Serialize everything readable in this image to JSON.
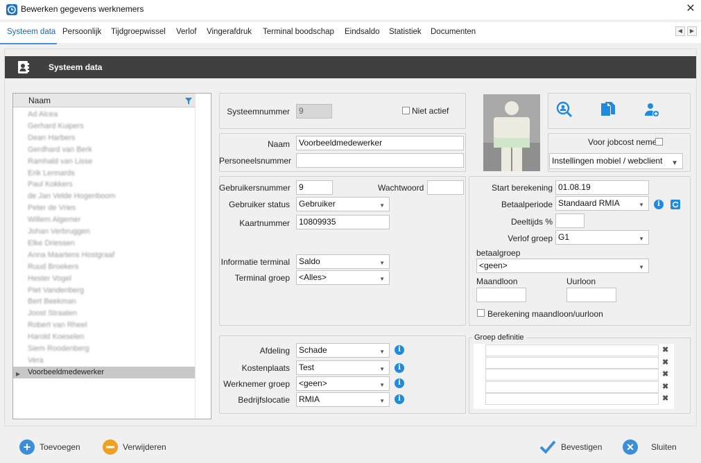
{
  "window": {
    "title": "Bewerken gegevens werknemers",
    "close_glyph": "✕",
    "icon": "app-clock-icon"
  },
  "tabs": [
    {
      "label": "Systeem data",
      "active": true
    },
    {
      "label": "Persoonlijk"
    },
    {
      "label": "Tijdgroepwissel"
    },
    {
      "label": "Verlof"
    },
    {
      "label": "Vingerafdruk"
    },
    {
      "label": "Terminal boodschap"
    },
    {
      "label": "Eindsaldo"
    },
    {
      "label": "Statistiek"
    },
    {
      "label": "Documenten"
    }
  ],
  "tab_nav": {
    "prev": "◀",
    "next": "▶"
  },
  "section": {
    "title": "Systeem data",
    "icon": "contact-card-icon"
  },
  "employee_list": {
    "header": "Naam",
    "rows": [
      "Ad Alcea",
      "Gerhard Kuipers",
      "Dean Harbers",
      "Gerdhard van Berk",
      "Ramhald van Lisse",
      "Erik Lennards",
      "Paul Kokkers",
      "de Jan Velde Hogenboom",
      "Peter de Vries",
      "Willem Algemer",
      "Johan Verbruggen",
      "Elke Driessen",
      "Anna Maartens Hostgraaf",
      "Ruud Broekers",
      "Hester Vogel",
      "Piet Vandenberg",
      "Bert Beekman",
      "Joost Straaten",
      "Robert van Rheel",
      "Harold Koeselen",
      "Siem Roodenberg",
      "Vera",
      "Voorbeeldmedewerker"
    ],
    "selected_index": 22,
    "row_pointer": "▶"
  },
  "system": {
    "systeemnummer_label": "Systeemnummer",
    "systeemnummer": "9",
    "niet_actief_label": "Niet actief",
    "niet_actief": false
  },
  "identity": {
    "naam_label": "Naam",
    "naam": "Voorbeeldmedewerker",
    "personeelsnummer_label": "Personeelsnummer",
    "personeelsnummer": ""
  },
  "actions": {
    "icons": [
      "search-user-icon",
      "documents-icon",
      "add-user-icon"
    ],
    "jobcost_label": "Voor jobcost nemen",
    "jobcost": false,
    "mobile_select": "Instellingen mobiel / webclient"
  },
  "terminal": {
    "gebruikersnummer_label": "Gebruikersnummer",
    "gebruikersnummer": "9",
    "wachtwoord_label": "Wachtwoord",
    "wachtwoord": "",
    "gebruiker_status_label": "Gebruiker status",
    "gebruiker_status": "Gebruiker",
    "kaartnummer_label": "Kaartnummer",
    "kaartnummer": "10809935",
    "informatie_terminal_label": "Informatie terminal",
    "informatie_terminal": "Saldo",
    "terminal_groep_label": "Terminal groep",
    "terminal_groep": "<Alles>"
  },
  "payroll": {
    "start_berekening_label": "Start berekening",
    "start_berekening": "01.08.19",
    "betaalperiode_label": "Betaalperiode",
    "betaalperiode": "Standaard RMIA",
    "deeltijds_label": "Deeltijds %",
    "deeltijds": "",
    "verlof_groep_label": "Verlof groep",
    "verlof_groep": "G1",
    "betaalgroep_label": "betaalgroep",
    "betaalgroep": "<geen>",
    "maandloon_label": "Maandloon",
    "maandloon": "",
    "uurloon_label": "Uurloon",
    "uurloon": "",
    "berekening_label": "Berekening maandloon/uurloon",
    "berekening": false
  },
  "organisation": {
    "afdeling_label": "Afdeling",
    "afdeling": "Schade",
    "kostenplaats_label": "Kostenplaats",
    "kostenplaats": "Test",
    "werknemer_groep_label": "Werknemer groep",
    "werknemer_groep": "<geen>",
    "bedrijfslocatie_label": "Bedrijfslocatie",
    "bedrijfslocatie": "RMIA"
  },
  "group_definition": {
    "title": "Groep definitie",
    "rows": [
      "",
      "",
      "",
      "",
      ""
    ],
    "remove_glyph": "✖"
  },
  "footer": {
    "add_label": "Toevoegen",
    "delete_label": "Verwijderen",
    "confirm_label": "Bevestigen",
    "close_label": "Sluiten"
  },
  "colors": {
    "header_bg": "#404040",
    "accent_blue": "#1f8be0",
    "add_button": "#3b8fd9",
    "delete_button": "#f0a020",
    "confirm_check": "#3b8fd9",
    "close_button": "#3b8fd9"
  }
}
